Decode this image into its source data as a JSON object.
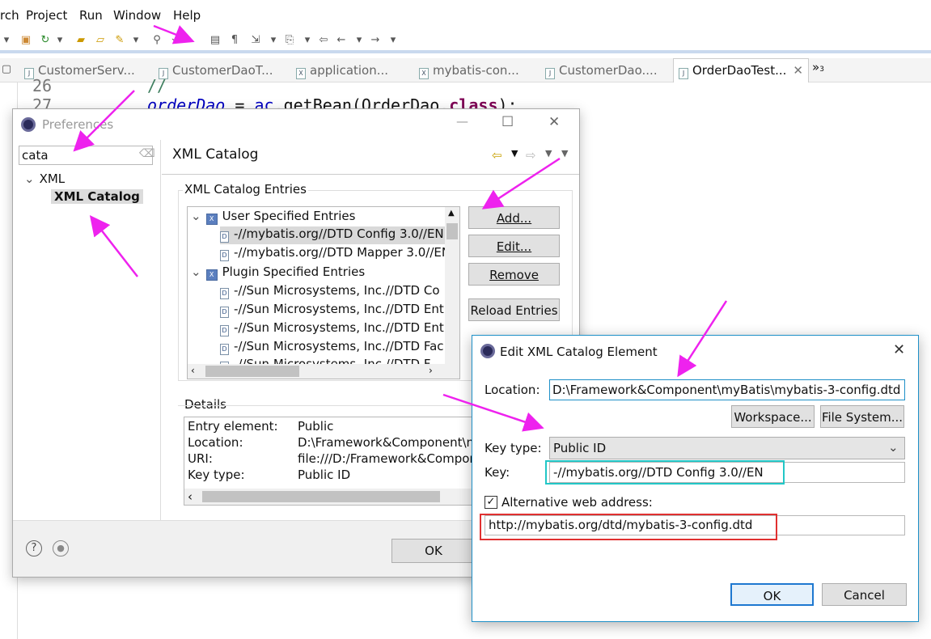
{
  "menu": {
    "items": [
      "rch",
      "Project",
      "Run",
      "Window",
      "Help"
    ]
  },
  "editor_tabs": [
    {
      "label": "CustomerServ...",
      "icon": "J"
    },
    {
      "label": "CustomerDaoT...",
      "icon": "J"
    },
    {
      "label": "application...",
      "icon": "X"
    },
    {
      "label": "mybatis-con...",
      "icon": "X"
    },
    {
      "label": "CustomerDao....",
      "icon": "J"
    },
    {
      "label": "OrderDaoTest...",
      "icon": "J",
      "active": true
    }
  ],
  "tab_overflow": "»",
  "tab_overflow_count": "3",
  "code": {
    "line_26": "26",
    "line_26_text": "//",
    "line_27": "27",
    "line_27_var": "orderDao",
    "line_27_eq": " = ",
    "line_27_ac": "ac",
    "line_27_rest": ".getBean(OrderDao.",
    "line_27_kw": "class",
    "line_27_end": ");"
  },
  "preferences": {
    "title": "Preferences",
    "filter_value": "cata",
    "tree": {
      "root": "XML",
      "child": "XML Catalog"
    },
    "page_title": "XML Catalog",
    "entries_group": "XML Catalog Entries",
    "entries": {
      "user_group": "User Specified Entries",
      "user_items": [
        "-//mybatis.org//DTD Config 3.0//EN",
        "-//mybatis.org//DTD Mapper 3.0//EN"
      ],
      "plugin_group": "Plugin Specified Entries",
      "plugin_items": [
        "-//Sun Microsystems, Inc.//DTD Co",
        "-//Sun Microsystems, Inc.//DTD Ent",
        "-//Sun Microsystems, Inc.//DTD Ent",
        "-//Sun Microsystems, Inc.//DTD Fac",
        "-//Sun Microsystems, Inc.//DTD F"
      ]
    },
    "buttons": {
      "add": "Add...",
      "edit": "Edit...",
      "remove": "Remove",
      "reload": "Reload Entries"
    },
    "details": {
      "label": "Details",
      "rows": [
        {
          "key": "Entry element:",
          "value": "Public"
        },
        {
          "key": "Location:",
          "value": "D:\\Framework&Component\\m"
        },
        {
          "key": "URI:",
          "value": "file:///D:/Framework&Compor"
        },
        {
          "key": "Key type:",
          "value": "Public ID"
        }
      ]
    },
    "ok": "OK"
  },
  "edit_dialog": {
    "title": "Edit XML Catalog Element",
    "location_label": "Location:",
    "location_value": "D:\\Framework&Component\\myBatis\\mybatis-3-config.dtd",
    "workspace_button": "Workspace...",
    "filesystem_button": "File System...",
    "keytype_label": "Key type:",
    "keytype_value": "Public ID",
    "key_label": "Key:",
    "key_value": "-//mybatis.org//DTD Config 3.0//EN",
    "alt_checkbox_label": "Alternative web address:",
    "alt_checked": true,
    "alt_value": "http://mybatis.org/dtd/mybatis-3-config.dtd",
    "ok": "OK",
    "cancel": "Cancel"
  },
  "colors": {
    "annotation_arrow": "#ee22ee",
    "key_highlight": "#22c7c7",
    "url_highlight": "#e03030",
    "dialog_border": "#1e90c8"
  }
}
